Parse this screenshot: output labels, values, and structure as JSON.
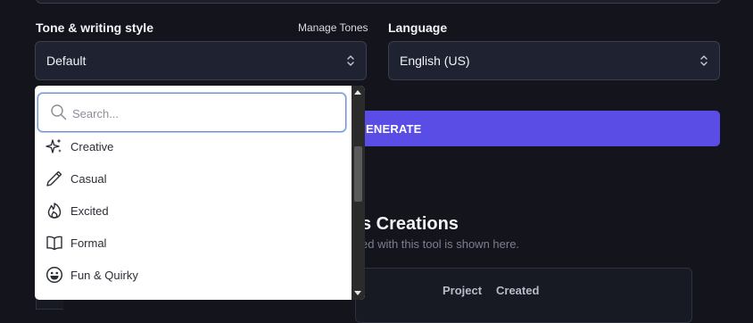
{
  "tone": {
    "label": "Tone & writing style",
    "manage_link": "Manage Tones",
    "selected": "Default"
  },
  "language": {
    "label": "Language",
    "selected": "English (US)"
  },
  "generate_button": "ENERATE",
  "creations": {
    "title": "s Creations",
    "subtitle": "ed with this tool is shown here.",
    "columns": [
      "Project",
      "Created"
    ]
  },
  "dropdown": {
    "search_placeholder": "Search...",
    "options": [
      {
        "label": "Creative",
        "icon": "sparkles-icon"
      },
      {
        "label": "Casual",
        "icon": "pencil-icon"
      },
      {
        "label": "Excited",
        "icon": "flame-icon"
      },
      {
        "label": "Formal",
        "icon": "book-open-icon"
      },
      {
        "label": "Fun & Quirky",
        "icon": "smile-icon"
      }
    ]
  },
  "colors": {
    "background": "#13141c",
    "accent": "#5a4de6",
    "focus_border": "#6a93cf"
  }
}
